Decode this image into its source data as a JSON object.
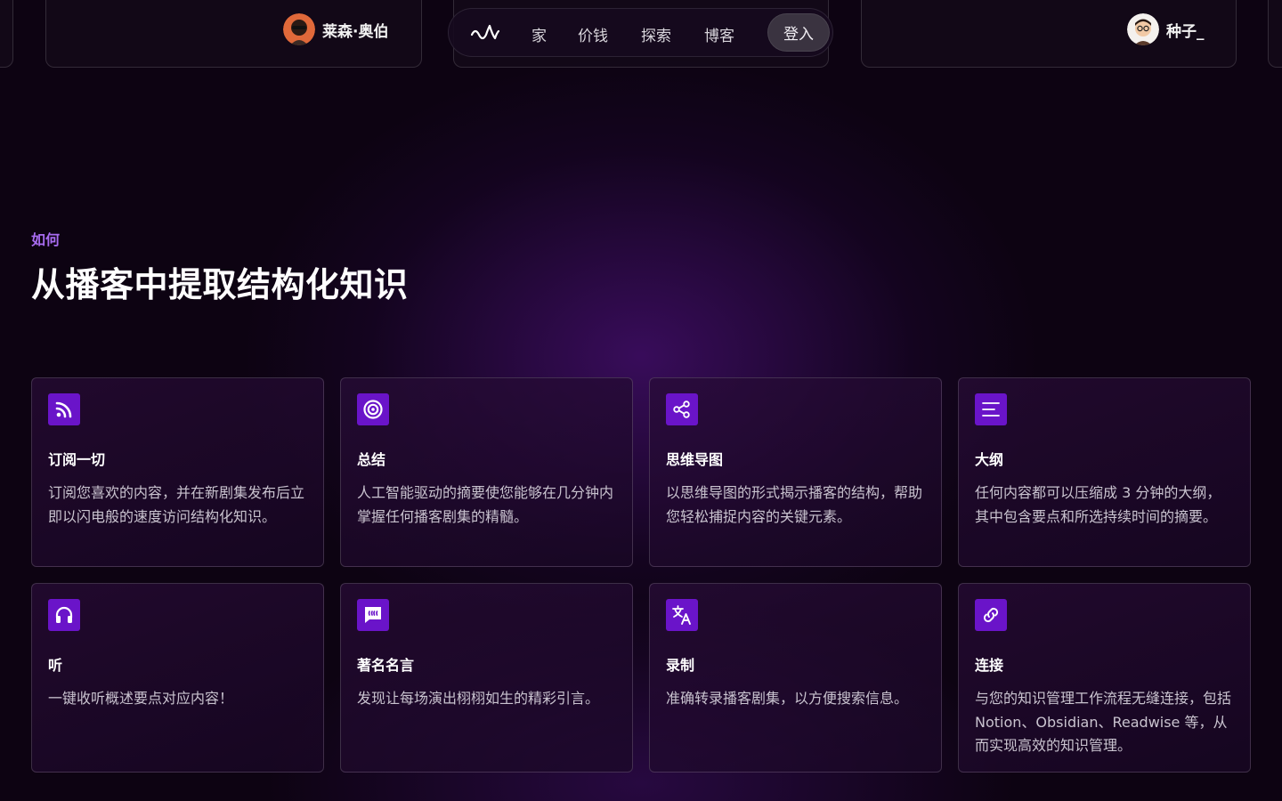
{
  "testimonials": {
    "left_user": {
      "name": "莱森·奥伯"
    },
    "right_user": {
      "name": "种子_"
    }
  },
  "nav": {
    "logo_icon": "wave-logo-icon",
    "items": [
      {
        "label": "家"
      },
      {
        "label": "价钱"
      },
      {
        "label": "探索"
      },
      {
        "label": "博客"
      }
    ],
    "login_label": "登入"
  },
  "section": {
    "eyebrow": "如何",
    "headline": "从播客中提取结构化知识"
  },
  "features": [
    {
      "icon": "rss-icon",
      "title": "订阅一切",
      "description": "订阅您喜欢的内容，并在新剧集发布后立即以闪电般的速度访问结构化知识。"
    },
    {
      "icon": "target-icon",
      "title": "总结",
      "description": "人工智能驱动的摘要使您能够在几分钟内掌握任何播客剧集的精髓。"
    },
    {
      "icon": "share-nodes-icon",
      "title": "思维导图",
      "description": "以思维导图的形式揭示播客的结构，帮助您轻松捕捉内容的关键元素。"
    },
    {
      "icon": "menu-lines-icon",
      "title": "大纲",
      "description": "任何内容都可以压缩成 3 分钟的大纲，其中包含要点和所选持续时间的摘要。"
    },
    {
      "icon": "headphones-icon",
      "title": "听",
      "description": "一键收听概述要点对应内容！"
    },
    {
      "icon": "quote-bubble-icon",
      "title": "著名名言",
      "description": "发现让每场演出栩栩如生的精彩引言。"
    },
    {
      "icon": "translate-icon",
      "title": "录制",
      "description": "准确转录播客剧集，以方便搜索信息。"
    },
    {
      "icon": "link-icon",
      "title": "连接",
      "description": "与您的知识管理工作流程无缝连接，包括 Notion、Obsidian、Readwise 等，从而实现高效的知识管理。"
    }
  ],
  "colors": {
    "accent": "#6a14c9",
    "eyebrow": "#a86cf0",
    "background": "#0d0312"
  }
}
